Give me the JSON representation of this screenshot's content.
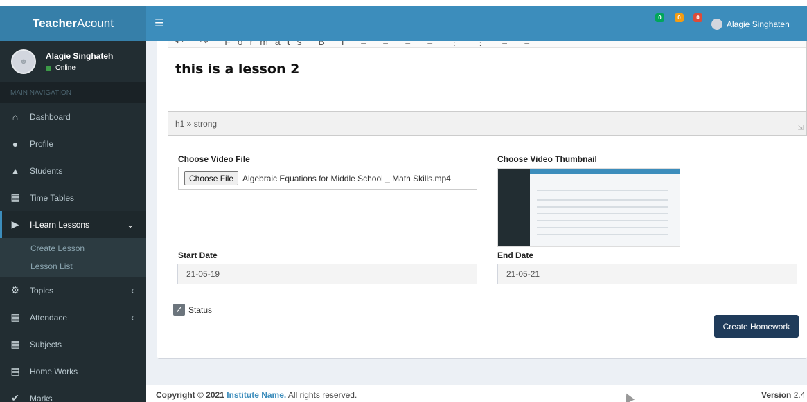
{
  "app": {
    "brand_bold": "Teacher",
    "brand_rest": "Acount"
  },
  "sidebar": {
    "user_name": "Alagie Singhateh",
    "user_status": "Online",
    "nav_header": "MAIN NAVIGATION",
    "items": [
      {
        "label": "Dashboard",
        "icon": "home-icon"
      },
      {
        "label": "Profile",
        "icon": "user-icon"
      },
      {
        "label": "Students",
        "icon": "graduation-cap-icon"
      },
      {
        "label": "Time Tables",
        "icon": "calendar-icon"
      },
      {
        "label": "I-Learn Lessons",
        "icon": "video-icon",
        "active": true
      },
      {
        "label": "Topics",
        "icon": "gear-icon"
      },
      {
        "label": "Attendace",
        "icon": "calendar-check-icon"
      },
      {
        "label": "Subjects",
        "icon": "grid-icon"
      },
      {
        "label": "Home Works",
        "icon": "document-icon"
      },
      {
        "label": "Marks",
        "icon": "check-icon"
      }
    ],
    "sub_items": [
      {
        "label": "Create Lesson"
      },
      {
        "label": "Lesson List"
      }
    ]
  },
  "header": {
    "user_name": "Alagie Singhateh",
    "notifications": [
      "0",
      "0",
      "0"
    ]
  },
  "editor": {
    "toolbar_label": "Formats",
    "content_heading": "this is a lesson 2",
    "status_path": "h1 » strong"
  },
  "form": {
    "video_label": "Choose Video File",
    "choose_file_button": "Choose File",
    "chosen_file": "Algebraic Equations for Middle School _ Math Skills.mp4",
    "thumbnail_label": "Choose Video Thumbnail",
    "start_date_label": "Start Date",
    "start_date_value": "21-05-19",
    "end_date_label": "End Date",
    "end_date_value": "21-05-21",
    "status_label": "Status",
    "status_checked": true,
    "submit_button": "Create Homework"
  },
  "footer": {
    "copyright_prefix": "Copyright © 2021",
    "institute_link": "Institute Name.",
    "rights": "All rights reserved.",
    "version_label": "Version",
    "version_value": "2.4"
  }
}
